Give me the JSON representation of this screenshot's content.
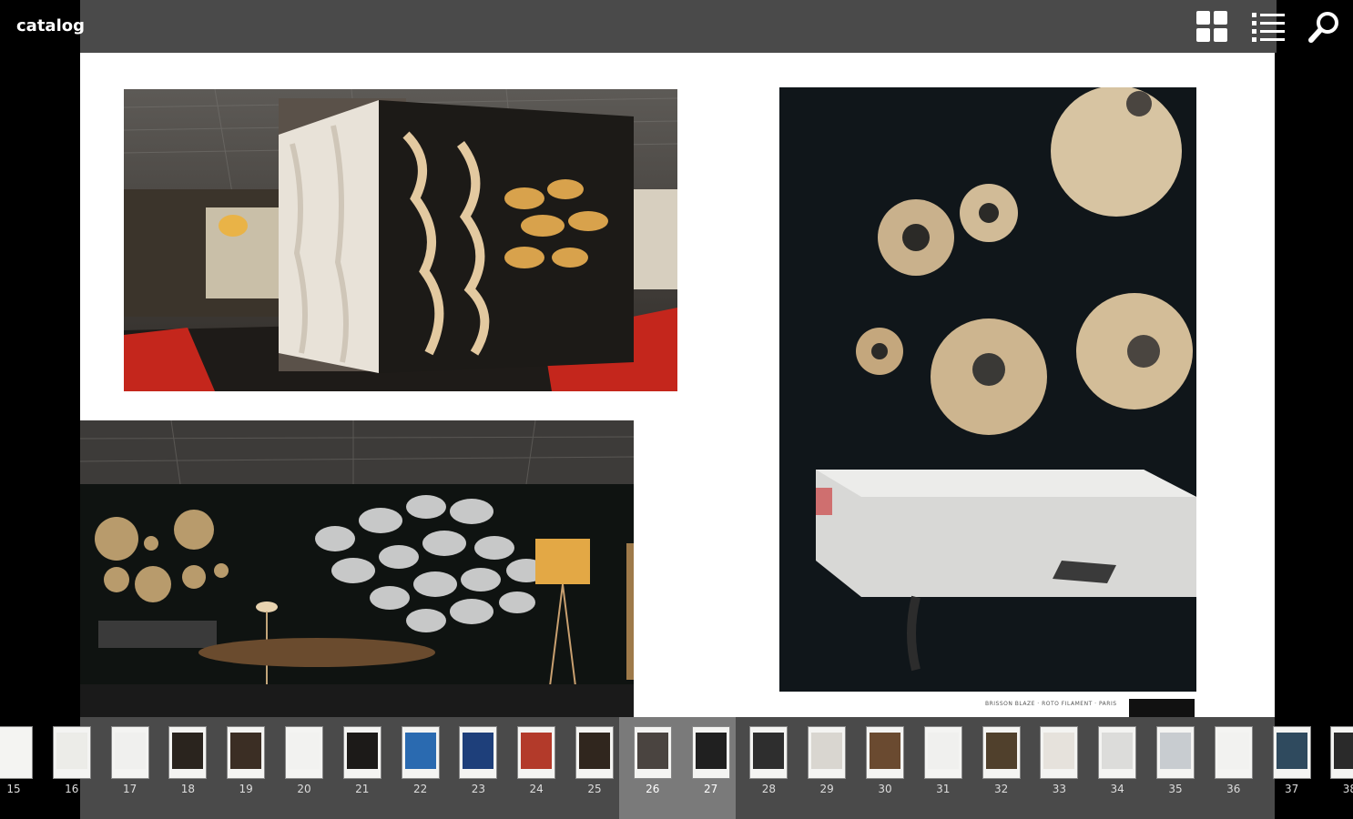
{
  "app": {
    "title": "catalog"
  },
  "toolbar": {
    "icons": [
      "grid-view-icon",
      "list-view-icon",
      "search-icon"
    ]
  },
  "page": {
    "caption": "BRISSON BLAZE · ROTO FILAMENT · PARIS"
  },
  "thumbnails": [
    {
      "label": "15"
    },
    {
      "label": "16"
    },
    {
      "label": "17"
    },
    {
      "label": "18"
    },
    {
      "label": "19"
    },
    {
      "label": "20"
    },
    {
      "label": "21"
    },
    {
      "label": "22"
    },
    {
      "label": "23"
    },
    {
      "label": "24"
    },
    {
      "label": "25"
    },
    {
      "label": "26"
    },
    {
      "label": "27"
    },
    {
      "label": "28"
    },
    {
      "label": "29"
    },
    {
      "label": "30"
    },
    {
      "label": "31"
    },
    {
      "label": "32"
    },
    {
      "label": "33"
    },
    {
      "label": "34"
    },
    {
      "label": "35"
    },
    {
      "label": "36"
    },
    {
      "label": "37"
    },
    {
      "label": "38"
    }
  ],
  "selected_pages": [
    "26",
    "27"
  ],
  "colors": {
    "toolbar_bg": "#4a4a4a",
    "strip_bg": "#4a4a4a",
    "selection_bg": "#7a7a7a",
    "page_bg": "#ffffff"
  }
}
